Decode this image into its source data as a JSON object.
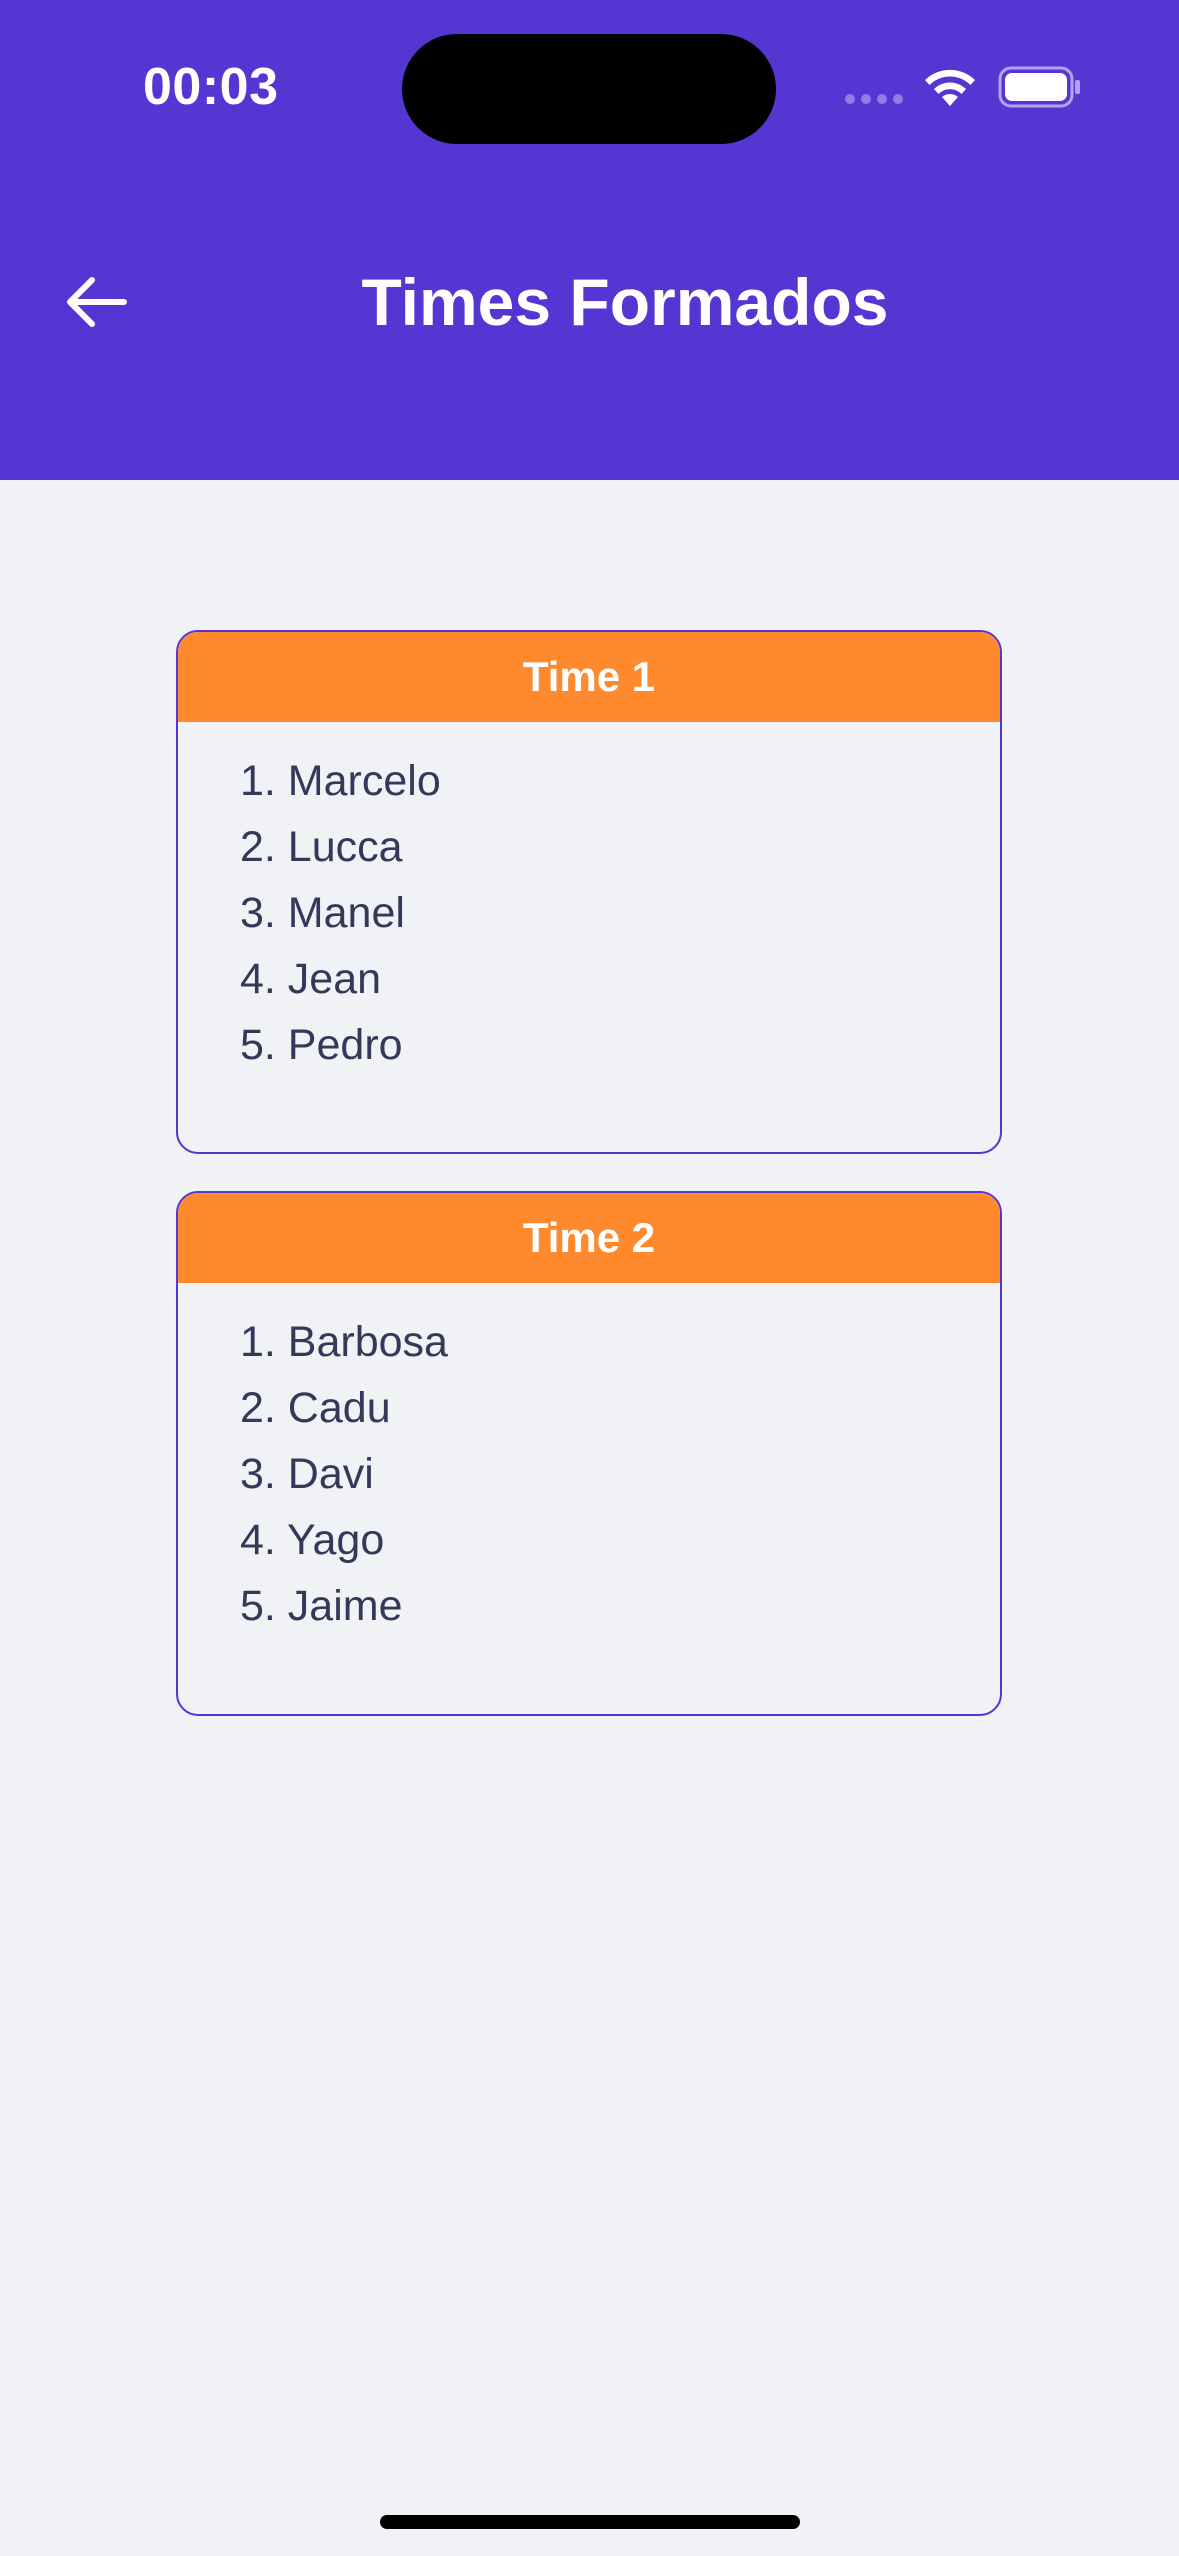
{
  "status_bar": {
    "time": "00:03",
    "icons": [
      "signal-icon",
      "wifi-icon",
      "battery-icon"
    ]
  },
  "header": {
    "back_icon": "arrow-left-icon",
    "title": "Times Formados"
  },
  "colors": {
    "header_bg": "#5536D3",
    "team_header_bg": "#FF8A2E",
    "page_bg": "#F1F2F6",
    "text": "#34395A"
  },
  "teams": [
    {
      "name": "Time 1",
      "players": [
        "1. Marcelo",
        "2. Lucca",
        "3. Manel",
        "4. Jean",
        "5. Pedro"
      ]
    },
    {
      "name": "Time 2",
      "players": [
        "1. Barbosa",
        "2. Cadu",
        "3. Davi",
        "4. Yago",
        "5. Jaime"
      ]
    }
  ]
}
